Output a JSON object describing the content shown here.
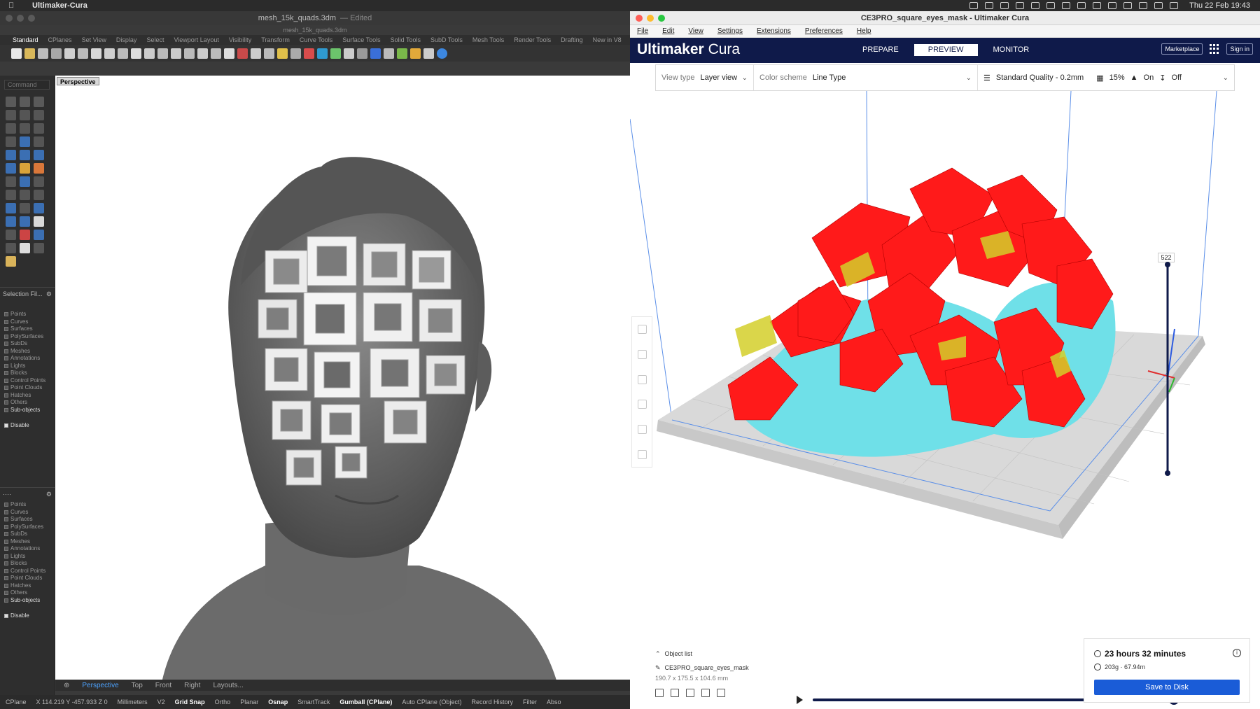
{
  "menubar": {
    "app_name": "Ultimaker-Cura",
    "clock": "Thu 22 Feb 19:43"
  },
  "rhino": {
    "title": "mesh_15k_quads.3dm",
    "edited": "— Edited",
    "subtitle": "mesh_15k_quads.3dm",
    "tabs": [
      "Standard",
      "CPlanes",
      "Set View",
      "Display",
      "Select",
      "Viewport Layout",
      "Visibility",
      "Transform",
      "Curve Tools",
      "Surface Tools",
      "Solid Tools",
      "SubD Tools",
      "Mesh Tools",
      "Render Tools",
      "Drafting",
      "New in V8"
    ],
    "command_placeholder": "Command",
    "viewport_label": "Perspective",
    "selection_filter_title": "Selection Fil...",
    "filters": [
      "Points",
      "Curves",
      "Surfaces",
      "PolySurfaces",
      "SubDs",
      "Meshes",
      "Annotations",
      "Lights",
      "Blocks",
      "Control Points",
      "Point Clouds",
      "Hatches",
      "Others"
    ],
    "sub_objects": "Sub-objects",
    "disable": "Disable",
    "viewport_tabs": [
      "Perspective",
      "Top",
      "Front",
      "Right",
      "Layouts..."
    ],
    "status": {
      "cplane": "CPlane",
      "coords": "X 114.219 Y -457.933 Z 0",
      "units": "Millimeters",
      "layer": "V2",
      "grid_snap": "Grid Snap",
      "ortho": "Ortho",
      "planar": "Planar",
      "osnap": "Osnap",
      "smarttrack": "SmartTrack",
      "gumball": "Gumball (CPlane)",
      "auto_cplane": "Auto CPlane (Object)",
      "record_history": "Record History",
      "filter": "Filter",
      "abso": "Abso"
    }
  },
  "cura": {
    "title": "CE3PRO_square_eyes_mask - Ultimaker Cura",
    "menu": [
      "File",
      "Edit",
      "View",
      "Settings",
      "Extensions",
      "Preferences",
      "Help"
    ],
    "logo_bold": "Ultimaker",
    "logo_light": "Cura",
    "stages": [
      "PREPARE",
      "PREVIEW",
      "MONITOR"
    ],
    "active_stage": "PREVIEW",
    "marketplace": "Marketplace",
    "sign_in": "Sign in",
    "view_type_label": "View type",
    "view_type_value": "Layer view",
    "color_scheme_label": "Color scheme",
    "color_scheme_value": "Line Type",
    "quality": "Standard Quality - 0.2mm",
    "infill": "15%",
    "support": "On",
    "adhesion": "Off",
    "layer_number": "522",
    "object_list_label": "Object list",
    "object_name": "CE3PRO_square_eyes_mask",
    "object_dims": "190.7 x 175.5 x 104.6 mm",
    "print_time": "23 hours 32 minutes",
    "material": "203g · 67.94m",
    "save_button": "Save to Disk",
    "colors": {
      "header": "#0f1a4a",
      "accent": "#1a5cd7",
      "wall_red": "#ff1a1a",
      "support_cyan": "#6fe0e8",
      "skin_yellow": "#d4cf2a"
    }
  }
}
